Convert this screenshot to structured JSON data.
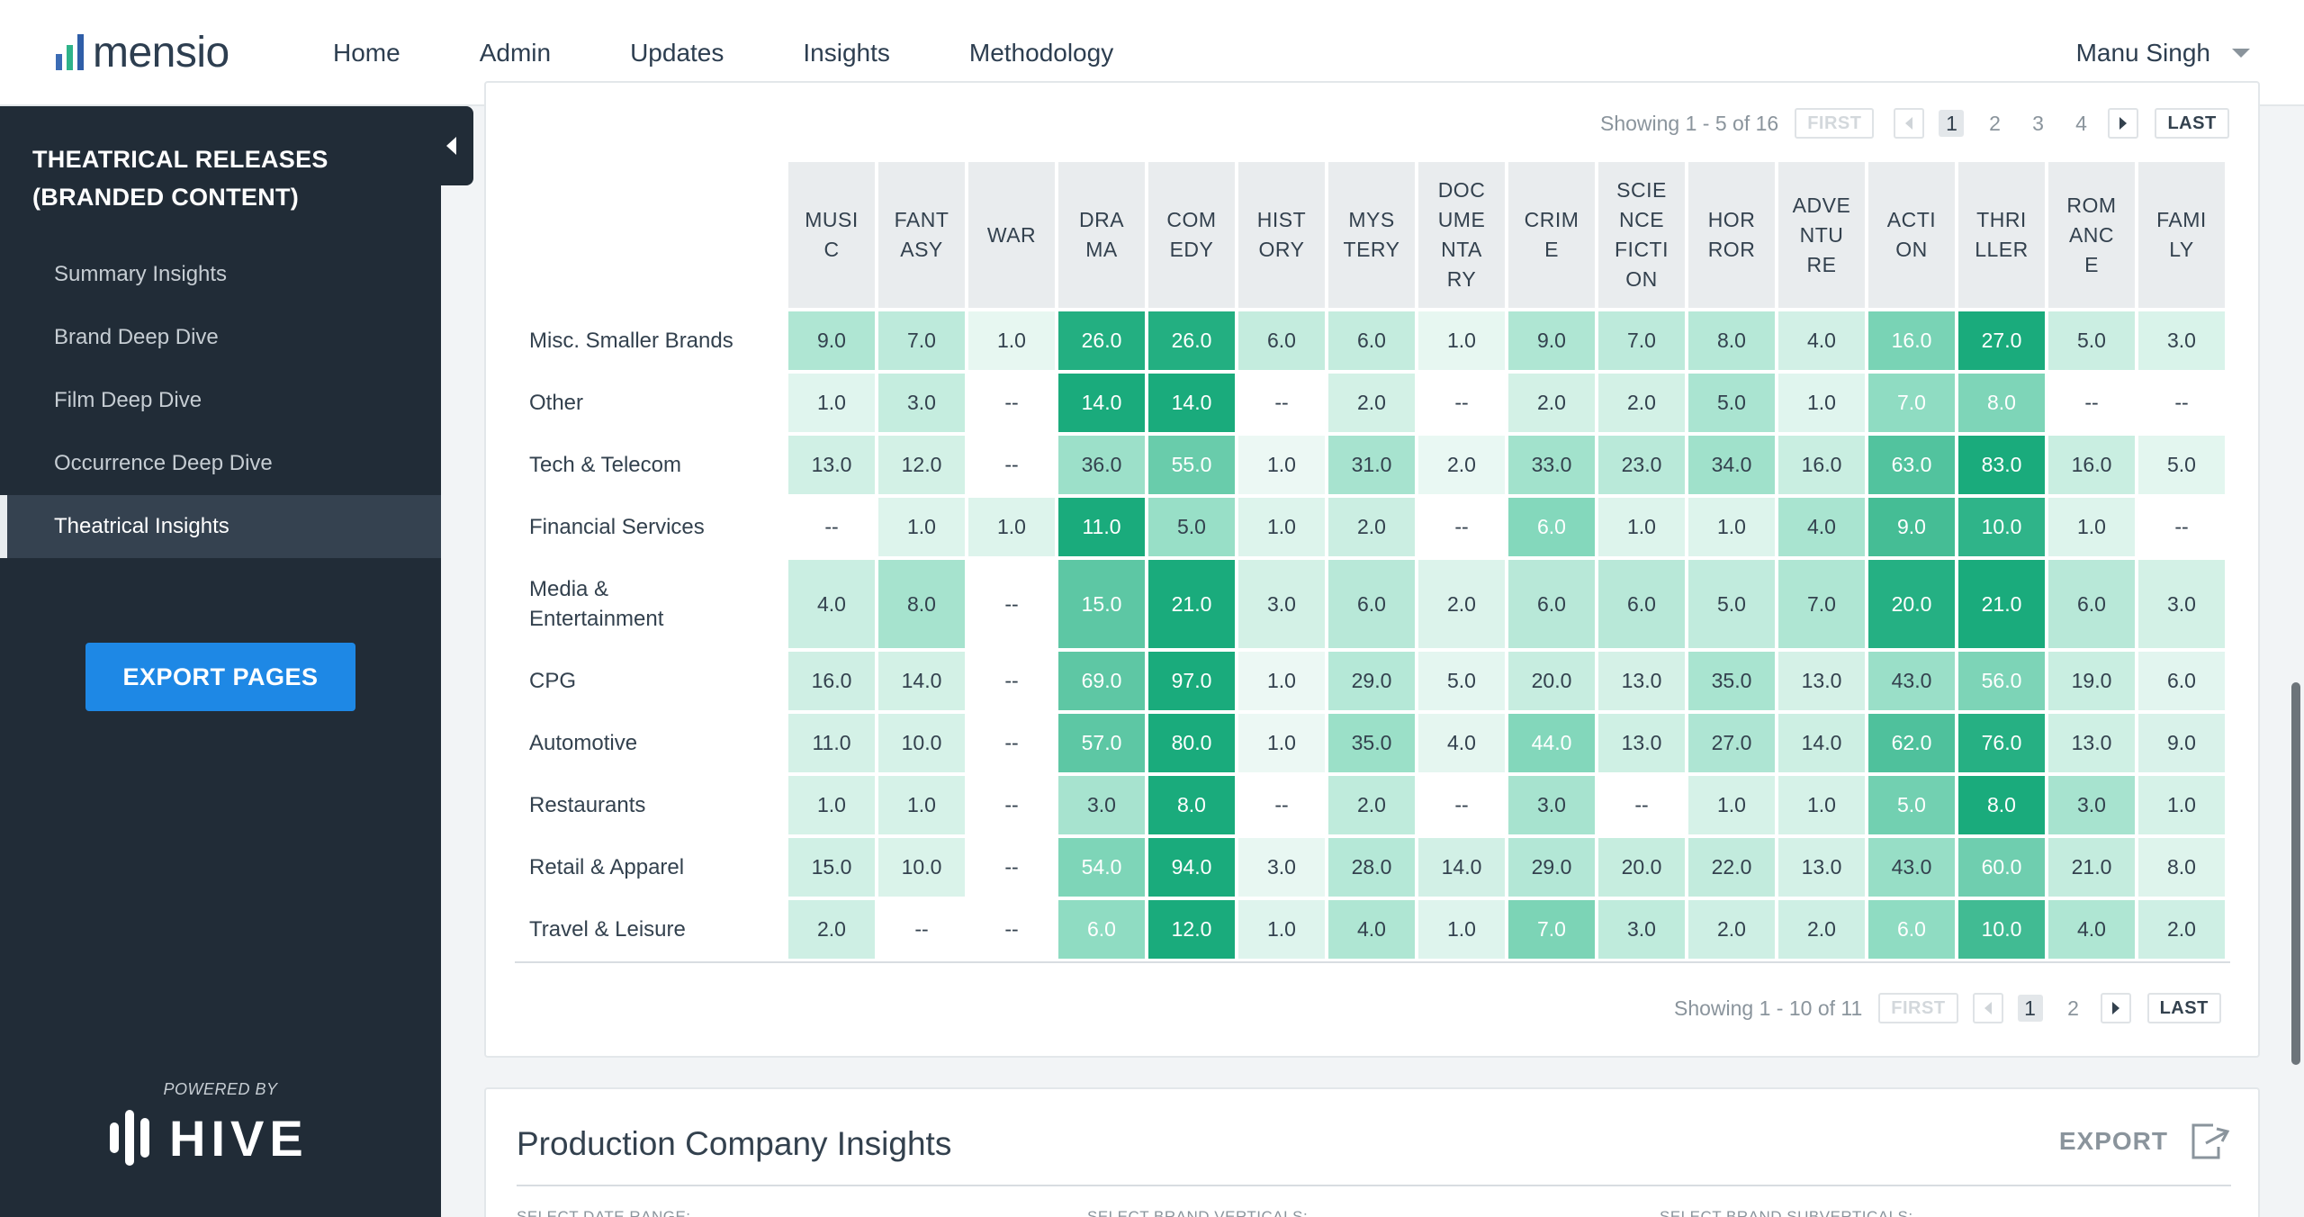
{
  "app": {
    "logo_text": "mensio",
    "user_name": "Manu Singh"
  },
  "nav": [
    "Home",
    "Admin",
    "Updates",
    "Insights",
    "Methodology"
  ],
  "sidebar": {
    "title": "THEATRICAL RELEASES (BRANDED CONTENT)",
    "items": [
      "Summary Insights",
      "Brand Deep Dive",
      "Film Deep Dive",
      "Occurrence Deep Dive",
      "Theatrical Insights"
    ],
    "active_index": 4,
    "export_label": "EXPORT PAGES",
    "powered_by": "POWERED BY",
    "partner": "HIVE"
  },
  "top_pager": {
    "showing": "Showing 1 - 5 of 16",
    "first": "FIRST",
    "last": "LAST",
    "pages": [
      "1",
      "2",
      "3",
      "4"
    ],
    "current": "1"
  },
  "bottom_pager": {
    "showing": "Showing 1 - 10 of 11",
    "first": "FIRST",
    "last": "LAST",
    "pages": [
      "1",
      "2"
    ],
    "current": "1"
  },
  "heatmap": {
    "columns": [
      "MUSIC",
      "FANTASY",
      "WAR",
      "DRAMA",
      "COMEDY",
      "HISTORY",
      "MYSTERY",
      "DOCUMENTARY",
      "CRIME",
      "SCIENCE FICTION",
      "HORROR",
      "ADVENTURE",
      "ACTION",
      "THRILLER",
      "ROMANCE",
      "FAMILY"
    ],
    "column_lines": [
      [
        "MUSI",
        "C"
      ],
      [
        "FANT",
        "ASY"
      ],
      [
        "WAR"
      ],
      [
        "DRA",
        "MA"
      ],
      [
        "COM",
        "EDY"
      ],
      [
        "HIST",
        "ORY"
      ],
      [
        "MYS",
        "TERY"
      ],
      [
        "DOC",
        "UME",
        "NTA",
        "RY"
      ],
      [
        "CRIM",
        "E"
      ],
      [
        "SCIE",
        "NCE",
        "FICTI",
        "ON"
      ],
      [
        "HOR",
        "ROR"
      ],
      [
        "ADVE",
        "NTU",
        "RE"
      ],
      [
        "ACTI",
        "ON"
      ],
      [
        "THRI",
        "LLER"
      ],
      [
        "ROM",
        "ANC",
        "E"
      ],
      [
        "FAMI",
        "LY"
      ]
    ],
    "rows": [
      {
        "label": "Misc. Smaller Brands",
        "values": [
          "9.0",
          "7.0",
          "1.0",
          "26.0",
          "26.0",
          "6.0",
          "6.0",
          "1.0",
          "9.0",
          "7.0",
          "8.0",
          "4.0",
          "16.0",
          "27.0",
          "5.0",
          "3.0"
        ]
      },
      {
        "label": "Other",
        "values": [
          "1.0",
          "3.0",
          "--",
          "14.0",
          "14.0",
          "--",
          "2.0",
          "--",
          "2.0",
          "2.0",
          "5.0",
          "1.0",
          "7.0",
          "8.0",
          "--",
          "--"
        ]
      },
      {
        "label": "Tech & Telecom",
        "values": [
          "13.0",
          "12.0",
          "--",
          "36.0",
          "55.0",
          "1.0",
          "31.0",
          "2.0",
          "33.0",
          "23.0",
          "34.0",
          "16.0",
          "63.0",
          "83.0",
          "16.0",
          "5.0"
        ]
      },
      {
        "label": "Financial Services",
        "values": [
          "--",
          "1.0",
          "1.0",
          "11.0",
          "5.0",
          "1.0",
          "2.0",
          "--",
          "6.0",
          "1.0",
          "1.0",
          "4.0",
          "9.0",
          "10.0",
          "1.0",
          "--"
        ]
      },
      {
        "label": "Media & Entertainment",
        "label_lines": [
          "Media &",
          "Entertainment"
        ],
        "values": [
          "4.0",
          "8.0",
          "--",
          "15.0",
          "21.0",
          "3.0",
          "6.0",
          "2.0",
          "6.0",
          "6.0",
          "5.0",
          "7.0",
          "20.0",
          "21.0",
          "6.0",
          "3.0"
        ]
      },
      {
        "label": "CPG",
        "values": [
          "16.0",
          "14.0",
          "--",
          "69.0",
          "97.0",
          "1.0",
          "29.0",
          "5.0",
          "20.0",
          "13.0",
          "35.0",
          "13.0",
          "43.0",
          "56.0",
          "19.0",
          "6.0"
        ]
      },
      {
        "label": "Automotive",
        "values": [
          "11.0",
          "10.0",
          "--",
          "57.0",
          "80.0",
          "1.0",
          "35.0",
          "4.0",
          "44.0",
          "13.0",
          "27.0",
          "14.0",
          "62.0",
          "76.0",
          "13.0",
          "9.0"
        ]
      },
      {
        "label": "Restaurants",
        "values": [
          "1.0",
          "1.0",
          "--",
          "3.0",
          "8.0",
          "--",
          "2.0",
          "--",
          "3.0",
          "--",
          "1.0",
          "1.0",
          "5.0",
          "8.0",
          "3.0",
          "1.0"
        ]
      },
      {
        "label": "Retail & Apparel",
        "values": [
          "15.0",
          "10.0",
          "--",
          "54.0",
          "94.0",
          "3.0",
          "28.0",
          "14.0",
          "29.0",
          "20.0",
          "22.0",
          "13.0",
          "43.0",
          "60.0",
          "21.0",
          "8.0"
        ]
      },
      {
        "label": "Travel & Leisure",
        "values": [
          "2.0",
          "--",
          "--",
          "6.0",
          "12.0",
          "1.0",
          "4.0",
          "1.0",
          "7.0",
          "3.0",
          "2.0",
          "2.0",
          "6.0",
          "10.0",
          "4.0",
          "2.0"
        ]
      }
    ],
    "color_scale": {
      "low": "#eef9f5",
      "mid": "#8fdcc2",
      "high": "#1aab7c",
      "empty": "#ffffff"
    }
  },
  "production_card": {
    "title": "Production Company Insights",
    "export_label": "EXPORT",
    "filters": [
      "SELECT DATE RANGE:",
      "SELECT BRAND VERTICALS:",
      "SELECT BRAND SUBVERTICALS:"
    ]
  }
}
